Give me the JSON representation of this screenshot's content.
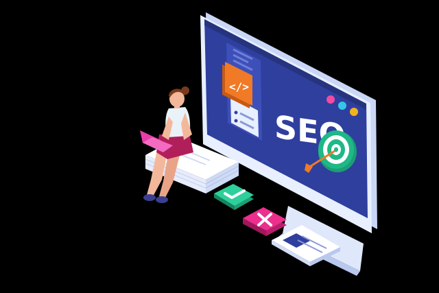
{
  "illustration": {
    "screen_heading": "SEO",
    "icons": {
      "code": "code-icon",
      "target": "target-icon",
      "arrow": "arrow-icon",
      "check": "check-icon",
      "close": "close-icon",
      "laptop": "laptop-icon"
    },
    "colors": {
      "background": "#000000",
      "screen": "#2f3f9e",
      "screen_dark": "#26347f",
      "monitor_frame": "#e8efff",
      "monitor_side": "#c9d6f5",
      "orange_tile": "#f07a26",
      "green_badge": "#2ecf9b",
      "pink_badge": "#ec2f8c",
      "target_green": "#1fb887",
      "dot_pink": "#f04da0",
      "dot_cyan": "#35c6e8",
      "dot_yellow": "#f3b21d",
      "laptop_pink": "#e83ea9"
    }
  }
}
